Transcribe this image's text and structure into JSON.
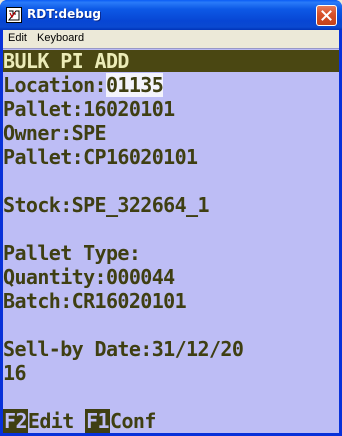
{
  "window": {
    "title": "RDT:debug"
  },
  "menu": {
    "items": [
      "Edit",
      "Keyboard"
    ]
  },
  "screen": {
    "header": "BULK PI ADD",
    "location_label": "Location:",
    "location_value": "01135",
    "pallet_line": "Pallet:16020101",
    "owner_line": "Owner:SPE",
    "pallet_cp_line": "Pallet:CP16020101",
    "stock_line": "Stock:SPE_322664_1",
    "pallet_type_line": "Pallet Type:",
    "quantity_line": "Quantity:000044",
    "batch_line": "Batch:CR16020101",
    "sellby_line1": "Sell-by Date:31/12/20",
    "sellby_line2": "16",
    "footer": {
      "f2_key": "F2",
      "f2_label": "Edit",
      "f1_key": "F1",
      "f1_label": "Conf"
    }
  },
  "colors": {
    "screen_bg": "#BDBDF5",
    "text": "#3F3F12",
    "header_bg": "#4A4712",
    "header_text": "#ECECB8",
    "title_bar": "#0746D4",
    "close_button": "#D9532B"
  }
}
